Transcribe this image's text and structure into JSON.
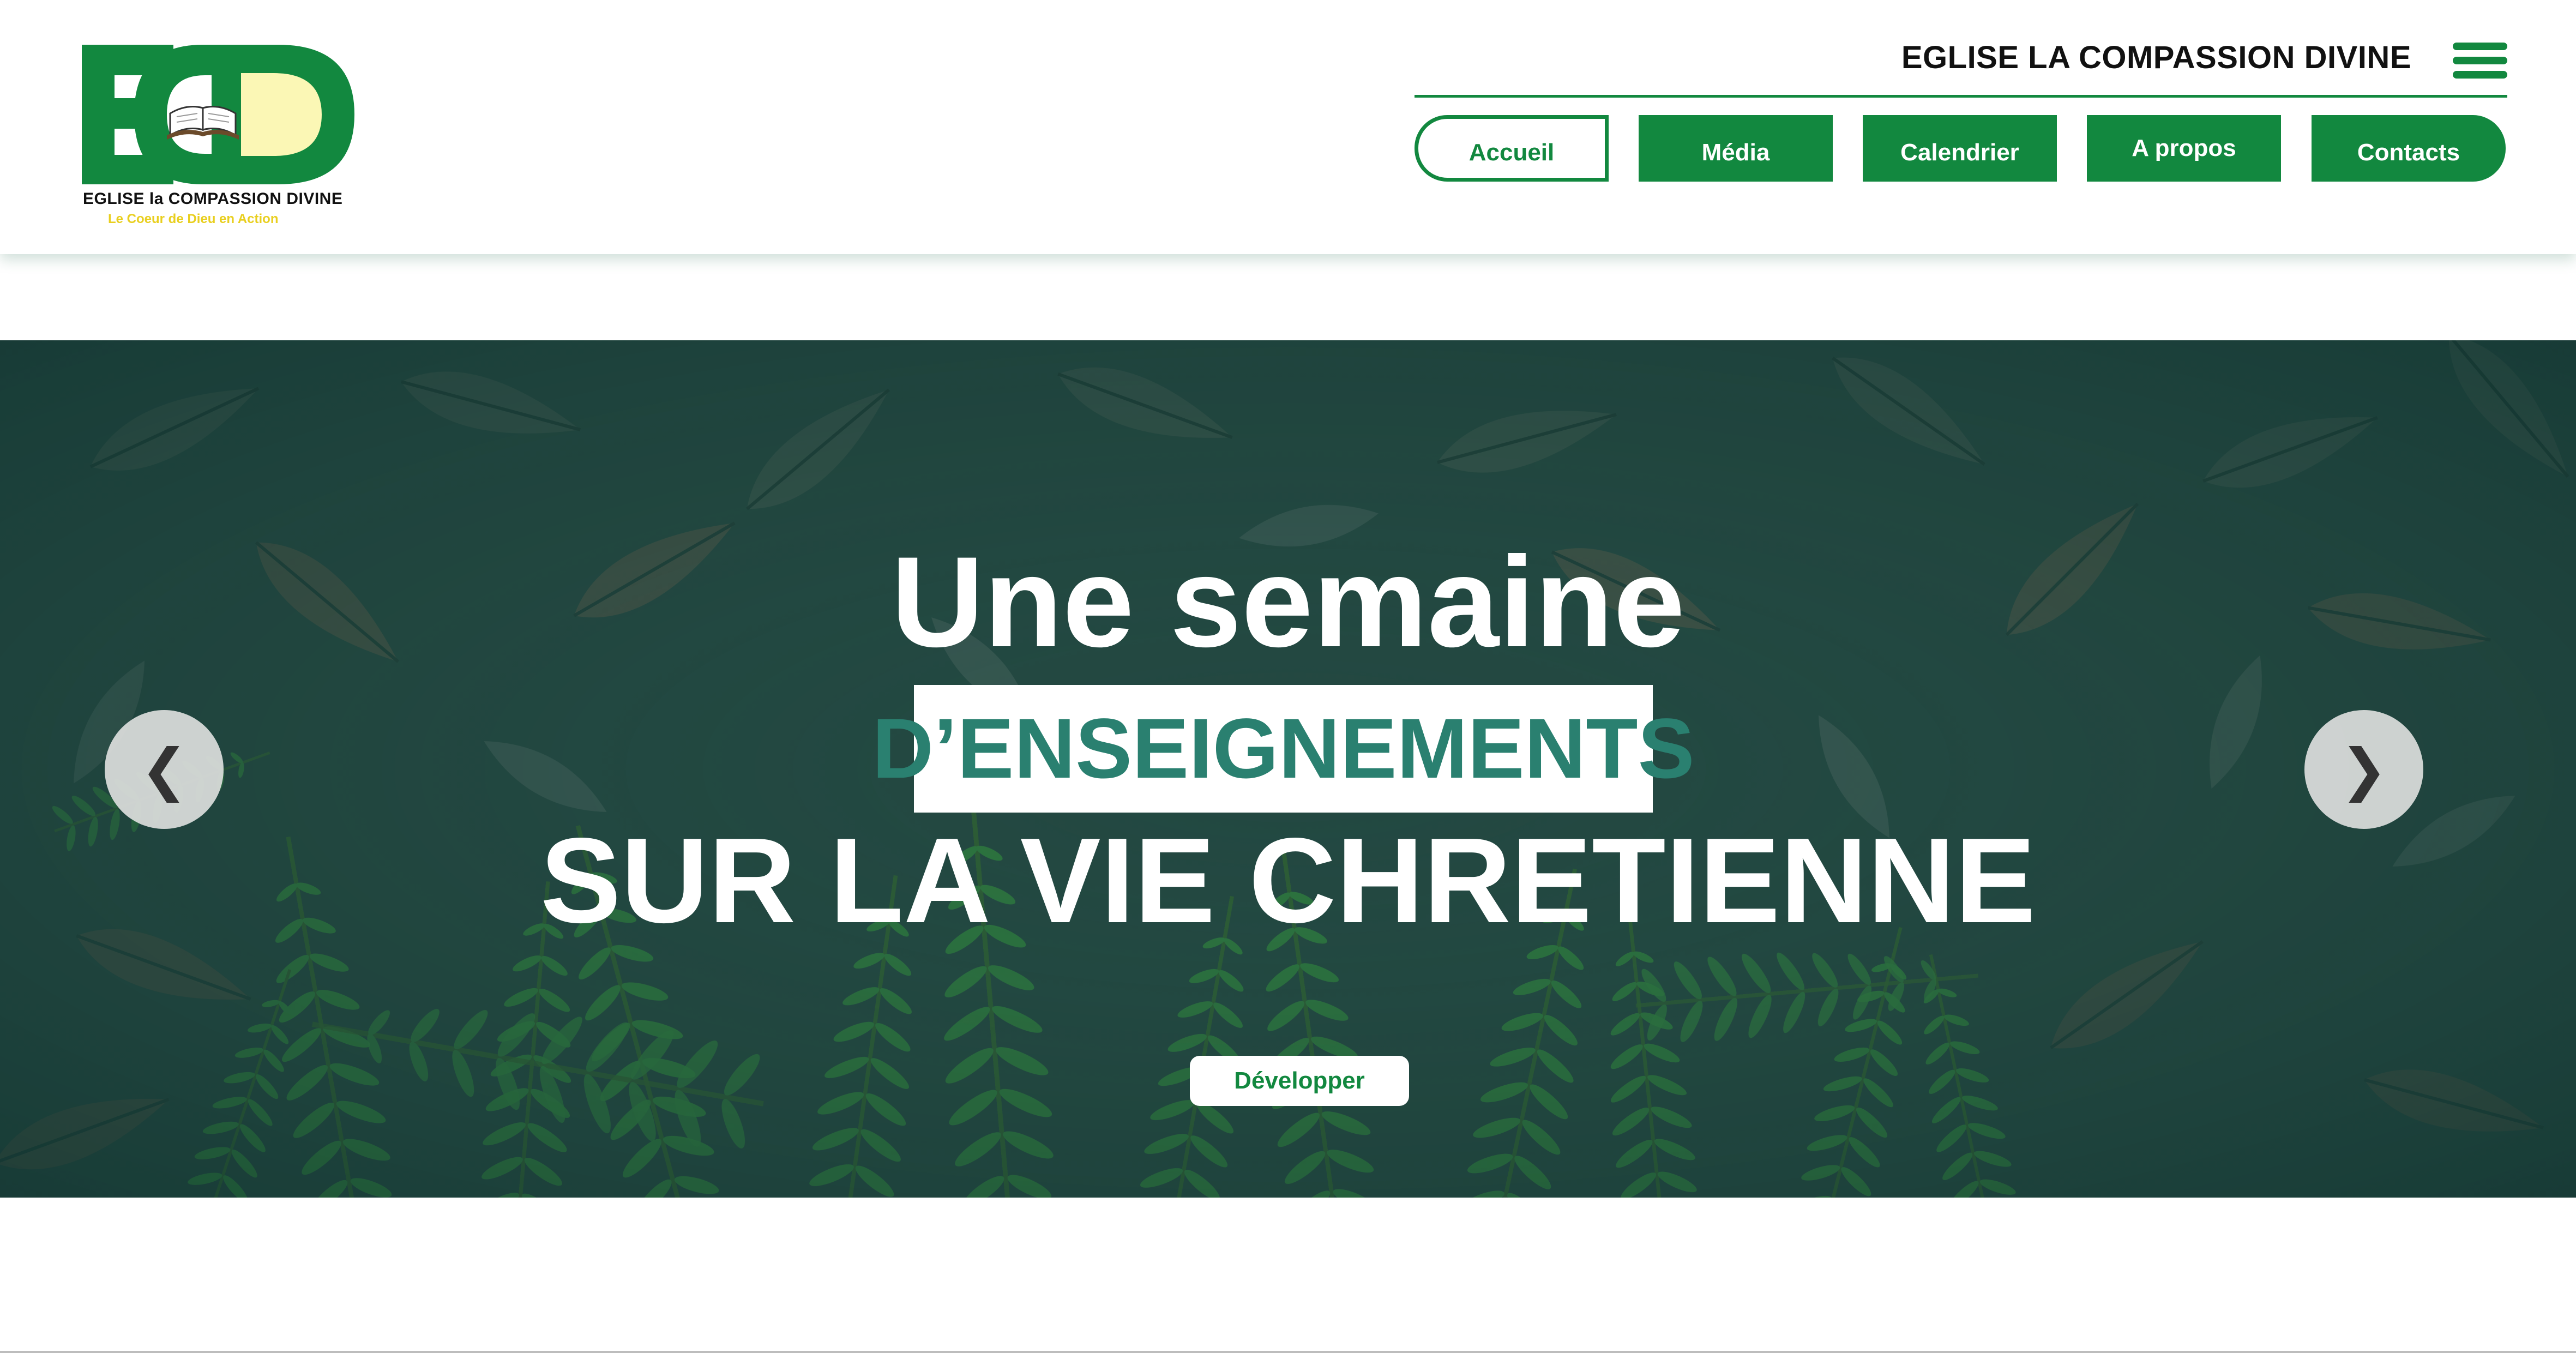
{
  "header": {
    "logo": {
      "letters": "ECD",
      "name": "EGLISE la COMPASSION DIVINE",
      "tagline": "Le Coeur de Dieu en Action",
      "icon": "open-bible-icon"
    },
    "site_title": "EGLISE LA COMPASSION DIVINE",
    "menu_icon": "hamburger-menu-icon"
  },
  "nav": {
    "items": [
      {
        "label": "Accueil",
        "active": true
      },
      {
        "label": "Média",
        "active": false
      },
      {
        "label": "Calendrier",
        "active": false
      },
      {
        "label": "A propos",
        "active": false
      },
      {
        "label": "Contacts",
        "active": false
      }
    ]
  },
  "hero": {
    "line1": "Une semaine",
    "line2": "D’ENSEIGNEMENTS",
    "line3": "SUR LA VIE CHRETIENNE",
    "cta_label": "Développer",
    "prev_arrow": "❮",
    "next_arrow": "❯",
    "background": "dark-leaves-and-fern-photo"
  },
  "colors": {
    "brand_green": "#12883f",
    "logo_yellow": "#fbf7b5",
    "tagline_yellow": "#e9cf1f",
    "headline_teal": "#2a8070"
  }
}
